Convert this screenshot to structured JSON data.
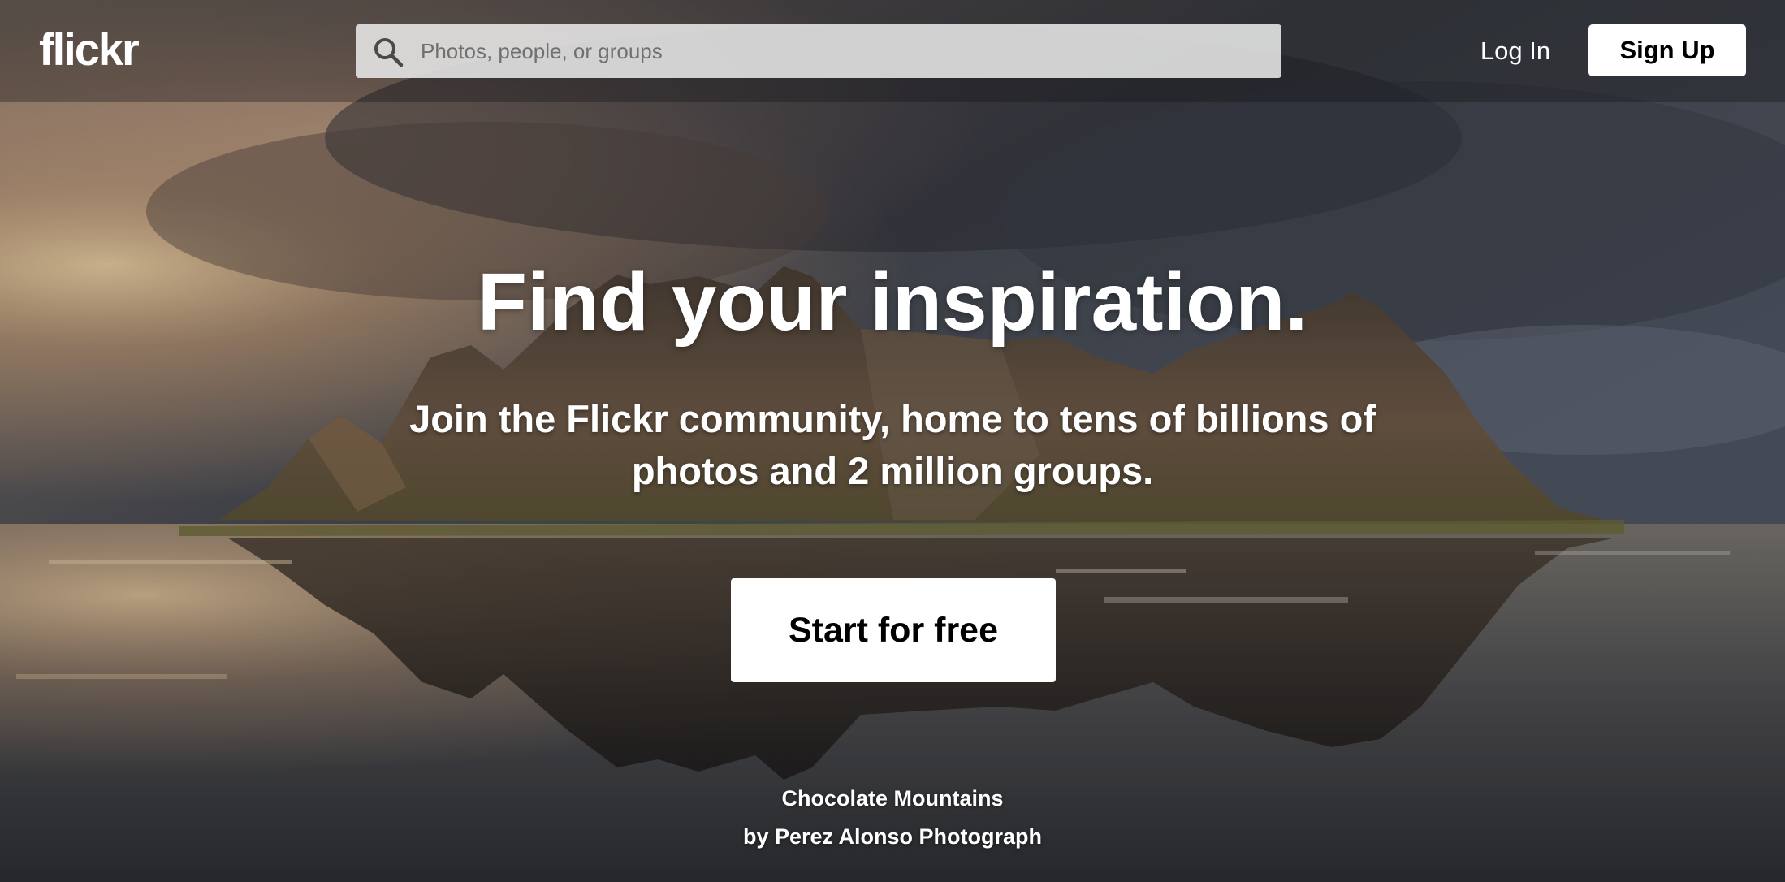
{
  "brand": {
    "logo_text": "flickr"
  },
  "search": {
    "placeholder": "Photos, people, or groups",
    "value": ""
  },
  "nav": {
    "login_label": "Log In",
    "signup_label": "Sign Up"
  },
  "hero": {
    "headline": "Find your inspiration.",
    "subheadline": "Join the Flickr community, home to tens of billions of photos and 2 million groups.",
    "cta_label": "Start for free"
  },
  "photo_credit": {
    "title": "Chocolate Mountains",
    "author": "by Perez Alonso Photograph"
  },
  "icons": {
    "search": "search-icon"
  },
  "colors": {
    "cta_background": "#ffffff",
    "signup_background": "#ffffff",
    "text_on_image": "#ffffff"
  }
}
